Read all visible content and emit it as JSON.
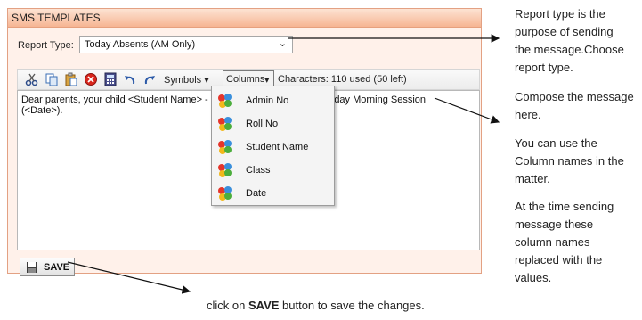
{
  "panel": {
    "title": "SMS TEMPLATES",
    "report_type_label": "Report Type:",
    "report_type_value": "Today Absents (AM Only)"
  },
  "toolbar": {
    "icons": [
      "cut-icon",
      "copy-icon",
      "paste-icon",
      "clear-icon",
      "calculator-icon",
      "undo-icon",
      "redo-icon"
    ],
    "symbols_label": "Symbols",
    "columns_label": "Columns",
    "characters_info": "Characters: 110 used (50 left)"
  },
  "editor": {
    "text_line1_a": "Dear parents, your child <Student Name> - <A",
    "text_line1_b": "chool Today Morning Session",
    "text_line2": "(<Date>)."
  },
  "columns_menu": [
    "Admin No",
    "Roll No",
    "Student Name",
    "Class",
    "Date"
  ],
  "save_label": "SAVE",
  "notes": {
    "report_type": [
      "Report type is the",
      "purpose of sending",
      "the message.Choose",
      "report type."
    ],
    "compose": [
      "Compose the message",
      "here."
    ],
    "columns": [
      "You can use the",
      "Column names in the",
      "matter."
    ],
    "replace": [
      "At the time sending",
      "message these",
      "column names",
      "replaced with the",
      "values."
    ],
    "save_prefix": "click on ",
    "save_bold": "SAVE",
    "save_suffix": " button to save the changes."
  },
  "colors": {
    "panel_border": "#e3a183",
    "header_gradient_top": "#fde3d3",
    "header_gradient_bottom": "#f6b593",
    "panel_background": "#fff1ea"
  }
}
